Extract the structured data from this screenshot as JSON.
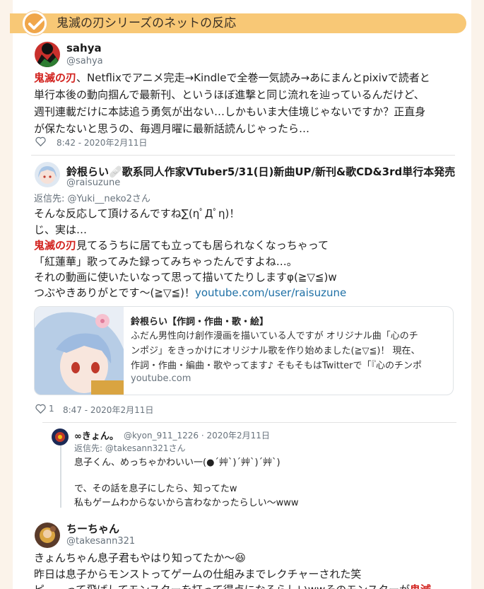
{
  "section": {
    "title": "鬼滅の刃シリーズのネットの反応",
    "icon": "check-icon"
  },
  "tweets": [
    {
      "name": "sahya",
      "handle": "@sahya",
      "lines": [
        {
          "hl": "鬼滅の刃",
          "text": "、Netflixでアニメ完走→Kindleで全巻一気読み→あにまんとpixivで読者と"
        },
        {
          "text": "単行本後の動向掴んで最新刊、というほぼ進撃と同じ流れを辿っているんだけど、"
        },
        {
          "text": "週刊連載だけに本誌追う勇気が出ない…しかもいま大佳境じゃないですか？正直身"
        },
        {
          "text": "が保たないと思うの、毎週月曜に最新話読んじゃったら…"
        }
      ],
      "time": "8:42 - 2020年2月11日"
    },
    {
      "name": "鈴根らい🩹歌系同人作家VTuber5/31(日)新曲UP/新刊&歌CD&3rd単行本発売",
      "handle": "@raisuzune",
      "reply_to": "返信先: @Yuki__neko2さん",
      "lines": [
        {
          "text": "そんな反応して頂けるんですね∑(ηﾟДﾟη)！"
        },
        {
          "text": "じ、実は…"
        },
        {
          "hl": "鬼滅の刃",
          "text": "見てるうちに居ても立っても居られなくなっちゃって"
        },
        {
          "text": "「紅蓮華」歌ってみた録ってみちゃったんですよね…。"
        },
        {
          "text": "それの動画に使いたいなって思って描いてたりしますφ(≧▽≦)w"
        },
        {
          "text": "つぶやきありがとです〜(≧▽≦)！",
          "link": "youtube.com/user/raisuzune"
        }
      ],
      "card": {
        "title": "鈴根らい【作詞・作曲・歌・絵】",
        "desc": [
          "ふだん男性向け創作漫画を描いている人ですが オリジナル曲「心のチ",
          "ンポジ」をきっかけにオリジナル歌を作り始めました(≧▽≦)！ 現在、",
          "作詞・作曲・編曲・歌やってます♪ そもそもはTwitterで「『心のチンポ"
        ],
        "domain": "youtube.com"
      },
      "likes": "1",
      "time": "8:47 - 2020年2月11日"
    },
    {
      "name": "∞きょん。",
      "handle": "@kyon_911_1226 · 2020年2月11日",
      "reply_to": "返信先: @takesann321さん",
      "lines": [
        {
          "text": "息子くん、めっちゃかわいい一(●´艸`)´艸`)´艸`)"
        },
        {
          "text": ""
        },
        {
          "text": "で、その話を息子にしたら、知ってたw"
        },
        {
          "text": "私もゲームわからないから言わなかったらしい〜www"
        }
      ]
    },
    {
      "name": "ちーちゃん",
      "handle": "@takesann321",
      "lines": [
        {
          "text": "きょんちゃん息子君もやはり知ってたか〜😆"
        },
        {
          "text": "昨日は息子からモンストってゲームの仕組みまでレクチャーされた笑"
        },
        {
          "text": "ピ……って飛ばしてモンスターを打って得点になるらしいwwそのモンスターが",
          "hl_end": "鬼滅"
        }
      ]
    }
  ],
  "colors": {
    "heading_bg": "#f8c876",
    "badge": "#f0a64a",
    "highlight": "#d2231f",
    "link": "#1d6fa5",
    "muted": "#68737d"
  }
}
